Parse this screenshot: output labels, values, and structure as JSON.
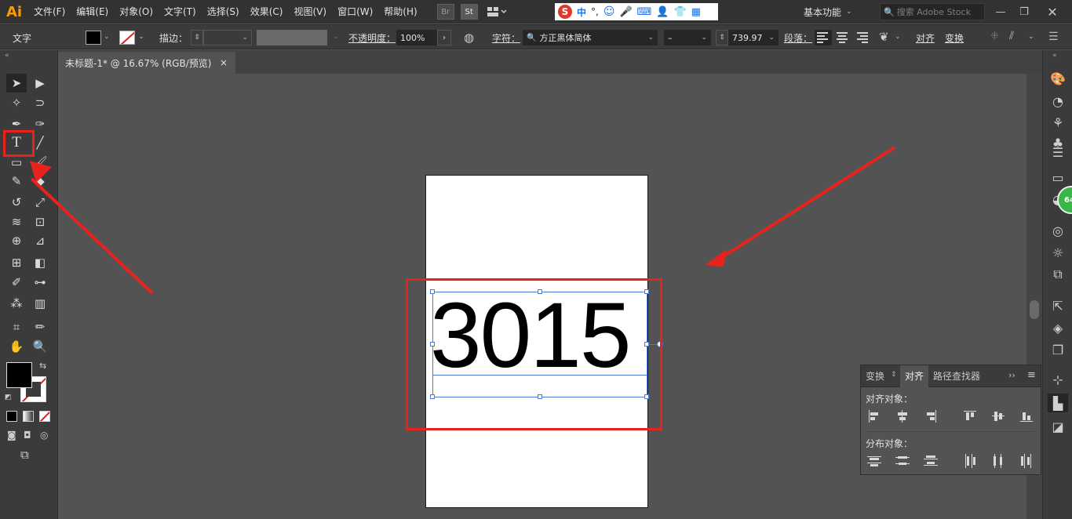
{
  "app": {
    "logo": "Ai"
  },
  "menu": [
    "文件(F)",
    "编辑(E)",
    "对象(O)",
    "文字(T)",
    "选择(S)",
    "效果(C)",
    "视图(V)",
    "窗口(W)",
    "帮助(H)"
  ],
  "menubar_icons": {
    "bridge": "Br",
    "stock": "St"
  },
  "ime": {
    "logo": "S",
    "mode": "中",
    "punct": "°,"
  },
  "workspace": {
    "label": "基本功能"
  },
  "search_stock": {
    "placeholder": "搜索 Adobe Stock"
  },
  "control_bar": {
    "tool_name": "文字",
    "stroke_label": "描边：",
    "opacity_label": "不透明度：",
    "opacity_value": "100%",
    "character_label": "字符：",
    "font_family": "方正黑体简体",
    "font_style": "–",
    "font_size": "739.97",
    "paragraph_label": "段落：",
    "align_label": "对齐",
    "transform_label": "变换"
  },
  "document_tab": {
    "title": "未标题-1* @ 16.67% (RGB/预览)",
    "close": "×"
  },
  "artboard": {
    "text": "3015"
  },
  "badge": {
    "value": "64"
  },
  "align_panel": {
    "tabs": [
      "变换",
      "对齐",
      "路径查找器"
    ],
    "active_tab": "对齐",
    "align_objects_label": "对齐对象：",
    "distribute_objects_label": "分布对象："
  },
  "colors": {
    "annotation_red": "#e8231e",
    "selection_blue": "#4b7bd6",
    "ui_dark": "#323232",
    "canvas": "#535353"
  }
}
